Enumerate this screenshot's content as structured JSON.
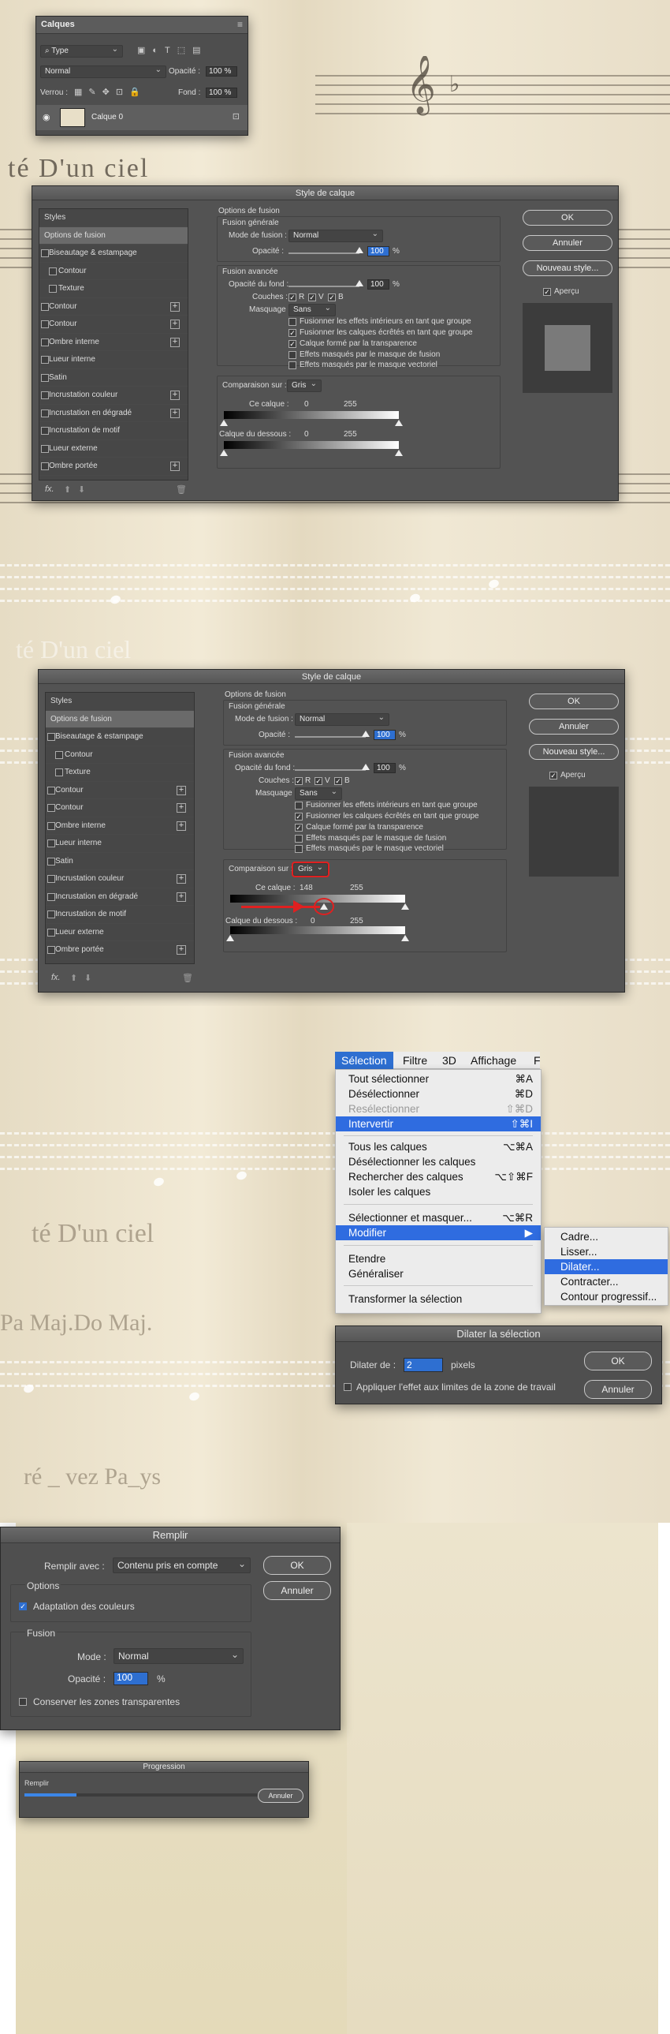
{
  "sheet": {
    "words1": "té D'un ciel",
    "words2": "Pa Maj.Do Maj.",
    "words3": "ré _ vez Pa_ys",
    "words4": "té D'un ciel"
  },
  "layers": {
    "title": "Calques",
    "filter": "Type",
    "blend": "Normal",
    "opacity_label": "Opacité :",
    "opacity": "100 %",
    "lock_label": "Verrou :",
    "fill_label": "Fond :",
    "fill": "100 %",
    "layer_name": "Calque 0"
  },
  "style_dialog": {
    "title": "Style de calque",
    "styles_header": "Styles",
    "items": [
      "Options de fusion",
      "Biseautage & estampage",
      "Contour",
      "Texture",
      "Contour",
      "Contour",
      "Ombre interne",
      "Lueur interne",
      "Satin",
      "Incrustation couleur",
      "Incrustation en dégradé",
      "Incrustation de motif",
      "Lueur externe",
      "Ombre portée"
    ],
    "options_header": "Options de fusion",
    "general_header": "Fusion générale",
    "mode_label": "Mode de fusion :",
    "mode": "Normal",
    "opacity_label": "Opacité :",
    "opacity": "100",
    "pct": "%",
    "advanced_header": "Fusion avancée",
    "fill_label": "Opacité du fond :",
    "fill": "100",
    "channels_label": "Couches :",
    "ch_r": "R",
    "ch_v": "V",
    "ch_b": "B",
    "knockout_label": "Masquage :",
    "knockout": "Sans",
    "checks": [
      "Fusionner les effets intérieurs en tant que groupe",
      "Fusionner les calques écrêtés en tant que groupe",
      "Calque formé par la transparence",
      "Effets masqués par le masque de fusion",
      "Effets masqués par le masque vectoriel"
    ],
    "blendif_label": "Comparaison sur :",
    "blendif": "Gris",
    "this_layer": "Ce calque :",
    "underlying": "Calque du dessous :",
    "v0": "0",
    "v255": "255",
    "v148": "148",
    "ok": "OK",
    "cancel": "Annuler",
    "new_style": "Nouveau style...",
    "preview": "Aperçu",
    "fx": "fx."
  },
  "menubar": {
    "items": [
      "Sélection",
      "Filtre",
      "3D",
      "Affichage",
      "F"
    ]
  },
  "select_menu": {
    "items": [
      {
        "label": "Tout sélectionner",
        "sc": "⌘A"
      },
      {
        "label": "Désélectionner",
        "sc": "⌘D"
      },
      {
        "label": "Resélectionner",
        "sc": "⇧⌘D"
      },
      {
        "label": "Intervertir",
        "sc": "⇧⌘I"
      },
      {
        "label": "Tous les calques",
        "sc": "⌥⌘A"
      },
      {
        "label": "Désélectionner les calques",
        "sc": ""
      },
      {
        "label": "Rechercher des calques",
        "sc": "⌥⇧⌘F"
      },
      {
        "label": "Isoler les calques",
        "sc": ""
      },
      {
        "label": "Sélectionner et masquer...",
        "sc": "⌥⌘R"
      },
      {
        "label": "Modifier",
        "sc": "▶"
      },
      {
        "label": "Etendre",
        "sc": ""
      },
      {
        "label": "Généraliser",
        "sc": ""
      },
      {
        "label": "Transformer la sélection",
        "sc": ""
      }
    ]
  },
  "modify_menu": {
    "items": [
      "Cadre...",
      "Lisser...",
      "Dilater...",
      "Contracter...",
      "Contour progressif..."
    ]
  },
  "expand": {
    "title": "Dilater la sélection",
    "label": "Dilater de :",
    "value": "2",
    "unit": "pixels",
    "apply": "Appliquer l'effet aux limites de la zone de travail",
    "ok": "OK",
    "cancel": "Annuler"
  },
  "fill": {
    "title": "Remplir",
    "use_label": "Remplir avec :",
    "use": "Contenu pris en compte",
    "options": "Options",
    "adapt": "Adaptation des couleurs",
    "blending": "Fusion",
    "mode_label": "Mode :",
    "mode": "Normal",
    "opacity_label": "Opacité :",
    "opacity": "100",
    "pct": "%",
    "preserve": "Conserver les zones transparentes",
    "ok": "OK",
    "cancel": "Annuler"
  },
  "progress": {
    "title": "Progression",
    "label": "Remplir",
    "cancel": "Annuler",
    "value": 0.22
  },
  "colors": {
    "ps_panel": "#535353",
    "accent": "#2e6fd1",
    "menu_active": "#2f6ce0",
    "annotation": "#e02020"
  }
}
